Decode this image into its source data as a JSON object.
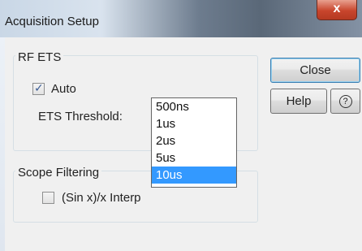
{
  "window": {
    "title": "Acquisition Setup",
    "close_glyph": "x"
  },
  "rf_ets": {
    "group_title": "RF ETS",
    "auto_label": "Auto",
    "auto_checked": true,
    "threshold_label": "ETS Threshold:",
    "threshold_value": "500ns",
    "options": [
      "500ns",
      "1us",
      "2us",
      "5us",
      "10us"
    ],
    "highlighted_option": "10us"
  },
  "scope_filtering": {
    "group_title": "Scope Filtering",
    "interp_label": "(Sin x)/x Interp",
    "interp_checked": false
  },
  "buttons": {
    "close": "Close",
    "help": "Help",
    "context_help_icon": "?"
  },
  "colors": {
    "selection": "#3399ff",
    "focus_border": "#3c7fb1"
  }
}
